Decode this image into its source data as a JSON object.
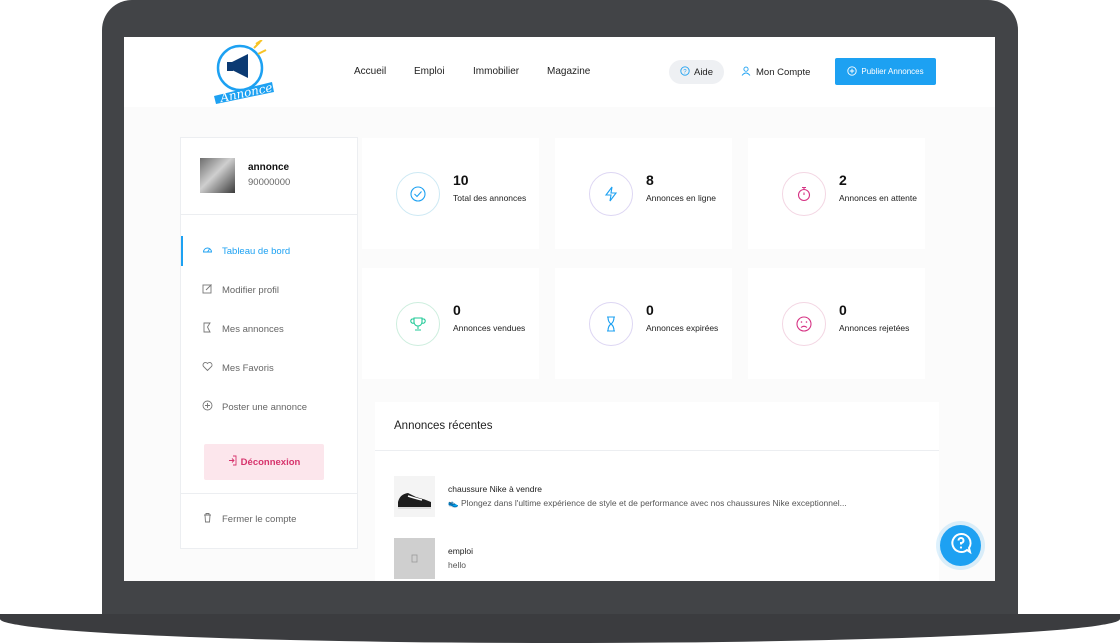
{
  "header": {
    "logo_text": "Annonce",
    "nav": [
      "Accueil",
      "Emploi",
      "Immobilier",
      "Magazine"
    ],
    "help_label": "Aide",
    "account_label": "Mon Compte",
    "publish_label": "Publier Annonces"
  },
  "profile": {
    "name": "annonce",
    "phone": "90000000"
  },
  "sidebar": {
    "items": [
      {
        "label": "Tableau de bord",
        "icon": "dashboard-icon",
        "active": true
      },
      {
        "label": "Modifier profil",
        "icon": "edit-icon",
        "active": false
      },
      {
        "label": "Mes annonces",
        "icon": "tag-icon",
        "active": false
      },
      {
        "label": "Mes Favoris",
        "icon": "heart-icon",
        "active": false
      },
      {
        "label": "Poster une annonce",
        "icon": "plus-circle-icon",
        "active": false
      }
    ],
    "logout_label": "Déconnexion",
    "close_account_label": "Fermer le compte"
  },
  "stats": [
    {
      "value": "10",
      "label": "Total des annonces",
      "icon": "check-circle-icon",
      "color": "#1da1f2"
    },
    {
      "value": "8",
      "label": "Annonces en ligne",
      "icon": "bolt-icon",
      "color": "#1da1f2"
    },
    {
      "value": "2",
      "label": "Annonces en attente",
      "icon": "stopwatch-icon",
      "color": "#d63384"
    },
    {
      "value": "0",
      "label": "Annonces vendues",
      "icon": "trophy-icon",
      "color": "#20c997"
    },
    {
      "value": "0",
      "label": "Annonces expirées",
      "icon": "hourglass-icon",
      "color": "#1da1f2"
    },
    {
      "value": "0",
      "label": "Annonces rejetées",
      "icon": "sad-face-icon",
      "color": "#d63384"
    }
  ],
  "recent": {
    "title": "Annonces récentes",
    "items": [
      {
        "title": "chaussure Nike à vendre",
        "description": "👟 Plongez dans l'ultime expérience de style et de performance avec nos chaussures Nike exceptionnel..."
      },
      {
        "title": "emploi",
        "description": "hello"
      }
    ]
  },
  "colors": {
    "accent": "#1da1f2",
    "danger": "#d6336c",
    "frame": "#424447"
  }
}
